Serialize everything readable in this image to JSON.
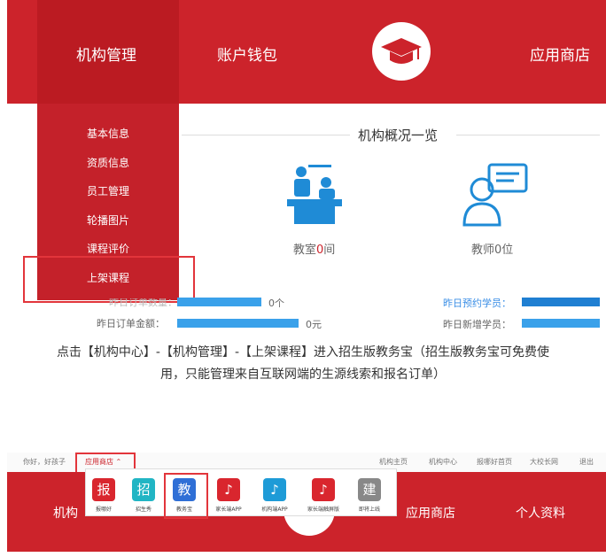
{
  "top": {
    "nav": [
      "机构管理",
      "账户钱包",
      "应用商店"
    ],
    "dropdown": [
      "基本信息",
      "资质信息",
      "员工管理",
      "轮播图片",
      "课程评价",
      "上架课程"
    ],
    "overview_title": "机构概况一览",
    "classroom": {
      "prefix": "教室",
      "count": "0",
      "suffix": "间"
    },
    "teacher": "教师0位",
    "partial_label": "昨日订单数量：",
    "partial_value": "0个",
    "order_amount_label": "昨日订单金额：",
    "order_amount_value": "0元",
    "reserve_label": "昨日预约学员：",
    "new_label": "昨日新增学员："
  },
  "caption": {
    "line1": "点击【机构中心】-【机构管理】-【上架课程】进入招生版教务宝（招生版教务宝可免费使",
    "line2": "用，只能管理来自互联网端的生源线索和报名订单）"
  },
  "bottom": {
    "greeting": "你好，好孩子",
    "appstore_link": "应用商店 ⌃",
    "top_links": [
      "机构主页",
      "机构中心",
      "报哪好首页",
      "大校长网",
      "退出"
    ],
    "apps": [
      {
        "glyph": "报",
        "label": "报哪好",
        "color": "#d9262e"
      },
      {
        "glyph": "招",
        "label": "招生秀",
        "color": "#21b5c4"
      },
      {
        "glyph": "教",
        "label": "教务宝",
        "color": "#2f6fd6"
      },
      {
        "glyph": "♪",
        "label": "家长端APP",
        "color": "#d9262e"
      },
      {
        "glyph": "♪",
        "label": "机构端APP",
        "color": "#1e9bd7"
      },
      {
        "glyph": "♪",
        "label": "家长端触屏版",
        "color": "#d9262e"
      },
      {
        "glyph": "建",
        "label": "即将上线",
        "color": "#888888"
      }
    ],
    "nav_partial": "机构",
    "nav": [
      "应用商店",
      "个人资料"
    ]
  },
  "colors": {
    "brand_red": "#cc232b",
    "accent_blue": "#3aa1ea",
    "highlight": "#e2353b"
  }
}
